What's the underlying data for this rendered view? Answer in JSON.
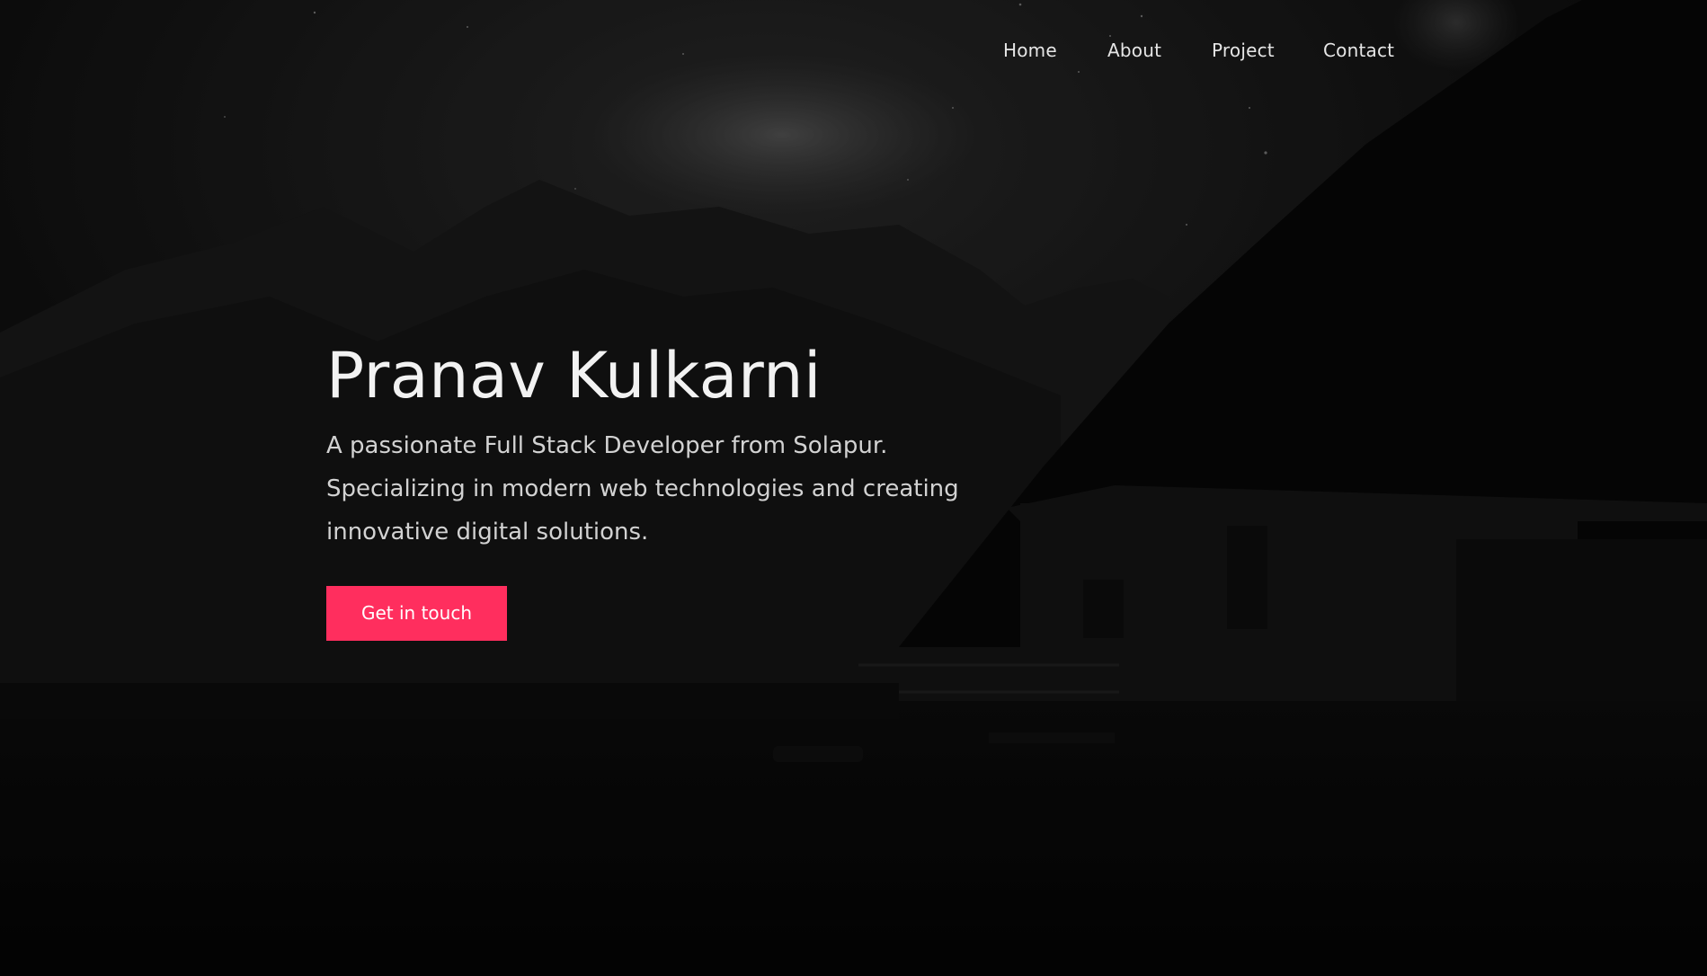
{
  "nav": {
    "items": [
      {
        "label": "Home"
      },
      {
        "label": "About"
      },
      {
        "label": "Project"
      },
      {
        "label": "Contact"
      }
    ]
  },
  "hero": {
    "name": "Pranav Kulkarni",
    "tagline_lines": [
      "A passionate Full Stack Developer from Solapur.",
      "Specializing in modern web technologies and creating",
      "innovative digital solutions."
    ],
    "cta_label": "Get in touch"
  },
  "colors": {
    "accent": "#ff2e5e",
    "background": "#060606",
    "text": "#f2f2f2"
  }
}
